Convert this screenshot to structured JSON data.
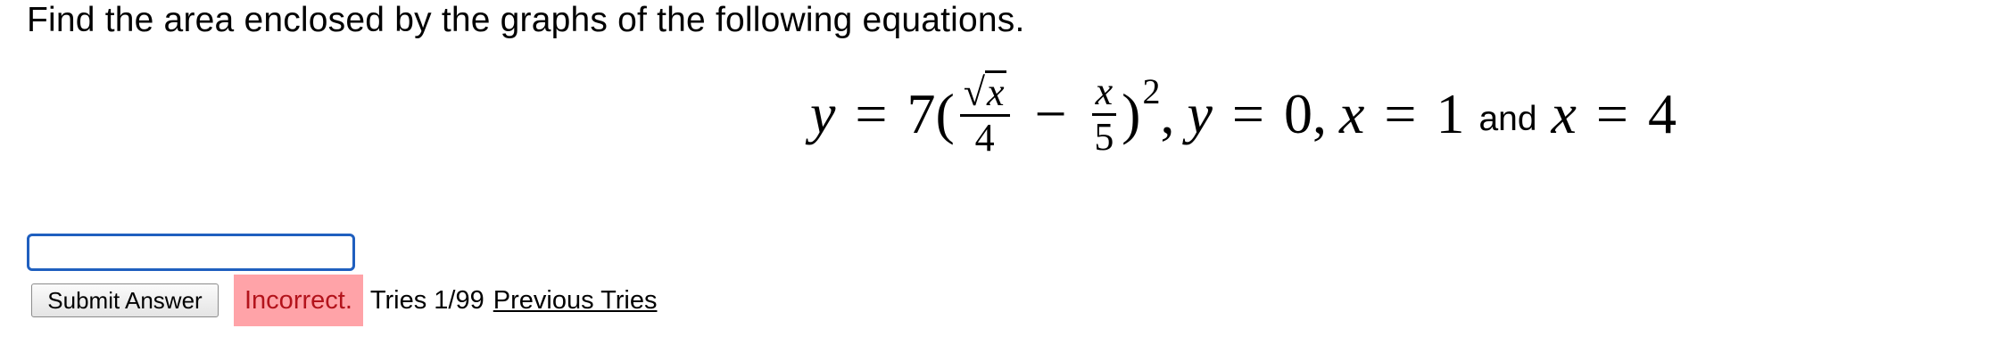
{
  "question": {
    "prompt": "Find the area enclosed by the graphs of the following equations."
  },
  "equation": {
    "y": "y",
    "eq": "=",
    "coef": "7(",
    "sqrt_symbol": "√",
    "sqrt_var": "x",
    "frac1_den": "4",
    "minus": "−",
    "frac2_num": "x",
    "frac2_den": "5",
    "close_paren": ")",
    "exponent": "2",
    "comma1": ",",
    "y2": "y",
    "eq2": "=",
    "zero": "0,",
    "x1": "x",
    "eq3": "=",
    "one": "1",
    "and_word": "and",
    "x2": "x",
    "eq4": "=",
    "four": "4"
  },
  "answer": {
    "value": "",
    "placeholder": ""
  },
  "controls": {
    "submit_label": "Submit Answer",
    "status": "Incorrect.",
    "tries": "Tries 1/99",
    "previous_tries": "Previous Tries"
  },
  "colors": {
    "incorrect_bg": "#ffa3a8",
    "incorrect_text": "#b3131b",
    "input_border": "#1f5fbf"
  }
}
